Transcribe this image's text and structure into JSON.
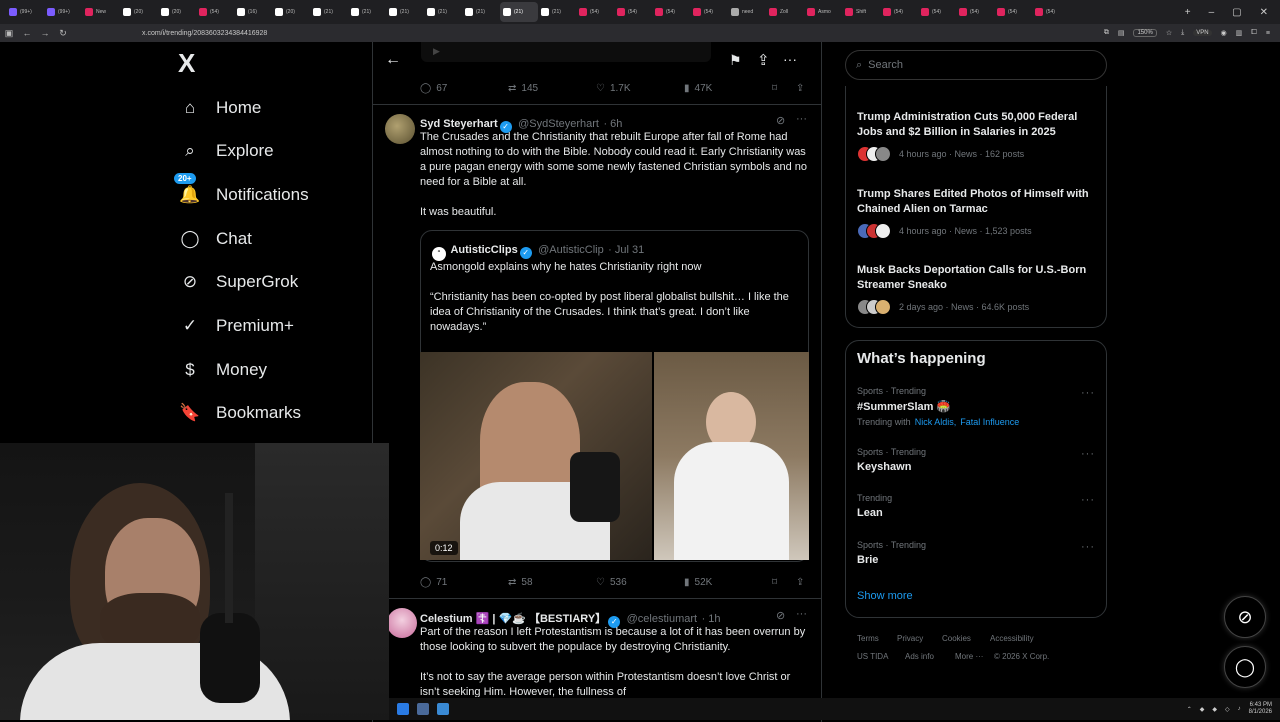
{
  "browser": {
    "tabs": [
      {
        "label": "(99+)",
        "color": "#7b5cff"
      },
      {
        "label": "(99+)",
        "color": "#7b5cff"
      },
      {
        "label": "New",
        "color": "#e0245e"
      },
      {
        "label": "(20)",
        "color": "#ffffff"
      },
      {
        "label": "(20)",
        "color": "#ffffff"
      },
      {
        "label": "(54)",
        "color": "#e0245e"
      },
      {
        "label": "(16)",
        "color": "#ffffff"
      },
      {
        "label": "(20)",
        "color": "#ffffff"
      },
      {
        "label": "(21)",
        "color": "#ffffff"
      },
      {
        "label": "(21)",
        "color": "#ffffff"
      },
      {
        "label": "(21)",
        "color": "#ffffff"
      },
      {
        "label": "(21)",
        "color": "#ffffff"
      },
      {
        "label": "(21)",
        "color": "#ffffff"
      },
      {
        "label": "(21)",
        "color": "#ffffff"
      },
      {
        "label": "(21)",
        "color": "#ffffff"
      },
      {
        "label": "(54)",
        "color": "#e0245e"
      },
      {
        "label": "(54)",
        "color": "#e0245e"
      },
      {
        "label": "(54)",
        "color": "#e0245e"
      },
      {
        "label": "(54)",
        "color": "#e0245e"
      },
      {
        "label": "need",
        "color": "#aaaaaa"
      },
      {
        "label": "Zoll",
        "color": "#e0245e"
      },
      {
        "label": "Asmo",
        "color": "#e0245e"
      },
      {
        "label": "Shift",
        "color": "#e0245e"
      },
      {
        "label": "(54)",
        "color": "#e0245e"
      },
      {
        "label": "(54)",
        "color": "#e0245e"
      },
      {
        "label": "(54)",
        "color": "#e0245e"
      },
      {
        "label": "(54)",
        "color": "#e0245e"
      },
      {
        "label": "(54)",
        "color": "#e0245e"
      }
    ],
    "url": "x.com/i/trending/2083603234384416928",
    "zoom": "150%",
    "vpn": "VPN"
  },
  "nav": {
    "logo": "X",
    "items": [
      {
        "label": "Home",
        "icon": "home-icon",
        "glyph": "⌂"
      },
      {
        "label": "Explore",
        "icon": "search-icon",
        "glyph": "⌕"
      },
      {
        "label": "Notifications",
        "icon": "bell-icon",
        "glyph": "🔔"
      },
      {
        "label": "Chat",
        "icon": "chat-icon",
        "glyph": "◯"
      },
      {
        "label": "SuperGrok",
        "icon": "grok-icon",
        "glyph": "⊘"
      },
      {
        "label": "Premium+",
        "icon": "verified-icon",
        "glyph": "✓"
      },
      {
        "label": "Money",
        "icon": "dollar-icon",
        "glyph": "$"
      },
      {
        "label": "Bookmarks",
        "icon": "bookmark-icon",
        "glyph": "🔖"
      }
    ],
    "notifications_badge": "20+"
  },
  "top_actions": {
    "replies": "67",
    "reposts": "145",
    "likes": "1.7K",
    "views": "47K"
  },
  "tweet1": {
    "name": "Syd Steyerhart",
    "handle": "@SydSteyerhart",
    "time": "· 6h",
    "text": "The Crusades and the Christianity that rebuilt Europe after fall of Rome had almost nothing to do with the Bible. Nobody could read it. Early Christianity was a pure pagan energy with some some newly fastened Christian symbols and no need for a Bible at all.\n\nIt was beautiful.",
    "quote": {
      "name": "AutisticClips",
      "handle": "@AutisticClip",
      "time": "· Jul 31",
      "text": "Asmongold explains why he hates Christianity right now\n\n“Christianity has been co-opted by post liberal globalist bullshit… I like the idea of Christianity of the Crusades. I think that’s great. I don’t like nowadays.”",
      "duration": "0:12"
    },
    "stats": {
      "replies": "71",
      "reposts": "58",
      "likes": "536",
      "views": "52K"
    }
  },
  "tweet2": {
    "name": "Celestium ☦️ | 💎☕ 【BESTIARY】",
    "handle": "@celestiumart",
    "time": "· 1h",
    "text": "Part of the reason I left Protestantism is because a lot of it has been overrun by those looking to subvert the populace by destroying Christianity.\n\nIt’s not to say the average person within Protestantism doesn’t love Christ or isn’t seeking Him. However, the fullness of"
  },
  "search": {
    "placeholder": "Search"
  },
  "news": [
    {
      "title": "Trump Administration Cuts 50,000 Federal Jobs and $2 Billion in Salaries in 2025",
      "meta": "4 hours ago · News · 162 posts"
    },
    {
      "title": "Trump Shares Edited Photos of Himself with Chained Alien on Tarmac",
      "meta": "4 hours ago · News · 1,523 posts"
    },
    {
      "title": "Musk Backs Deportation Calls for U.S.-Born Streamer Sneako",
      "meta": "2 days ago · News · 64.6K posts"
    }
  ],
  "happening": {
    "title": "What’s happening",
    "trends": [
      {
        "category": "Sports · Trending",
        "name": "#SummerSlam 🏟️",
        "extra_prefix": "Trending with",
        "extra_links": [
          "Nick Aldis,",
          "Fatal Influence"
        ]
      },
      {
        "category": "Sports · Trending",
        "name": "Keyshawn"
      },
      {
        "category": "Trending",
        "name": "Lean"
      },
      {
        "category": "Sports · Trending",
        "name": "Brie"
      }
    ],
    "show_more": "Show more"
  },
  "footer": {
    "links": [
      "Terms",
      "Privacy",
      "Cookies",
      "Accessibility",
      "US TIDA",
      "Ads info",
      "More ···",
      "© 2026 X Corp."
    ]
  },
  "tray": {
    "time": "6:43 PM",
    "date": "8/1/2026"
  },
  "colors": {
    "accent": "#1d9bf0",
    "text": "#e7e9ea",
    "muted": "#71767b",
    "border": "#2f3336"
  }
}
